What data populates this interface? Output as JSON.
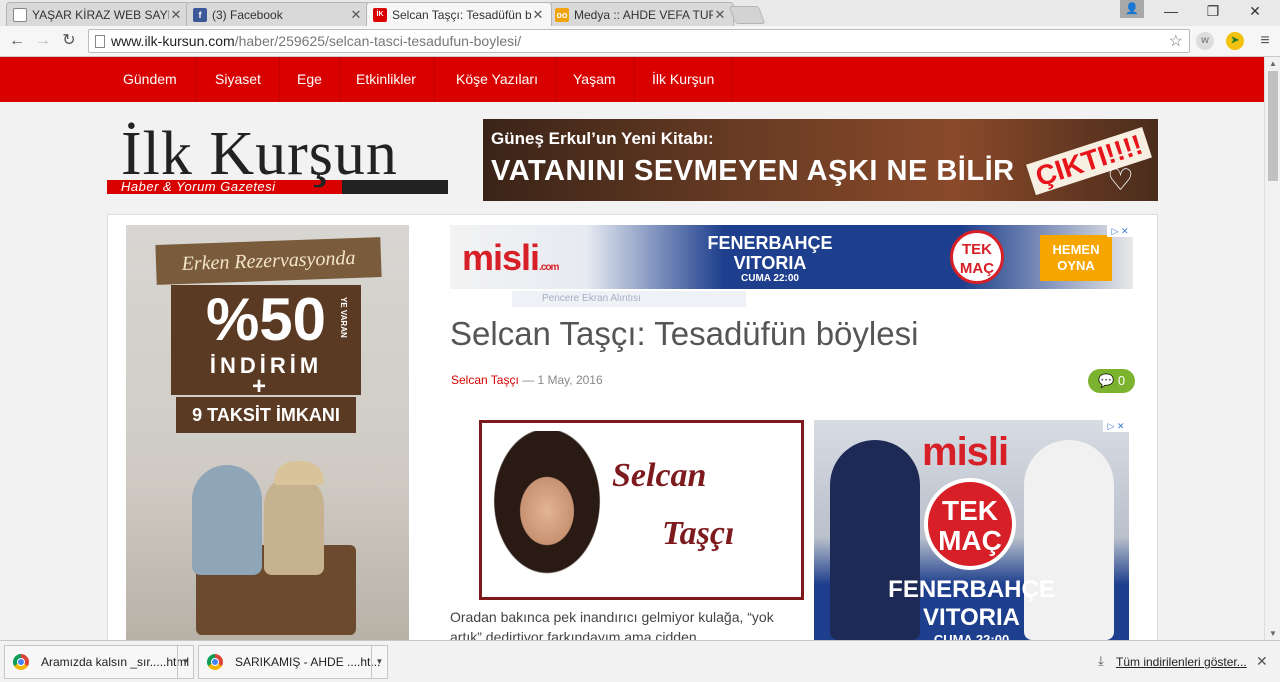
{
  "browser": {
    "tabs": [
      {
        "title": "YAŞAR KİRAZ WEB SAYFAS",
        "favicon": "page-icon"
      },
      {
        "title": "(3) Facebook",
        "favicon": "facebook-icon"
      },
      {
        "title": "Selcan Taşçı: Tesadüfün bö",
        "favicon": "ilk-kursun-icon"
      },
      {
        "title": "Medya :: AHDE VEFA TURA",
        "favicon": "owl-icon"
      }
    ],
    "url_host": "www.ilk-kursun.com",
    "url_path": "/haber/259625/selcan-tasci-tesadufun-boylesi/",
    "window_controls": {
      "minimize": "—",
      "restore": "❐",
      "close": "✕"
    }
  },
  "site": {
    "nav": [
      "Gündem",
      "Siyaset",
      "Ege",
      "Etkinlikler",
      "Köşe Yazıları",
      "Yaşam",
      "İlk Kurşun"
    ],
    "logo_text": "İlk Kurşun",
    "logo_subtitle": "Haber & Yorum Gazetesi",
    "colors": {
      "brand_red": "#d90000",
      "comment_green": "#7bb32e",
      "author_frame": "#7d1a1e"
    }
  },
  "banner_top": {
    "line1": "Güneş Erkul’un Yeni Kitabı:",
    "line2": "VATANINI SEVMEYEN AŞKI NE BİLİR",
    "badge": "ÇIKTI!!!!"
  },
  "side_ad": {
    "ribbon": "Erken Rezervasyonda",
    "percent": "%50",
    "ye_varan": "YE VARAN",
    "discount": "İNDİRİM",
    "plus": "+",
    "installments": "9 TAKSİT İMKANI"
  },
  "ad_strip": {
    "brand": "misli",
    "brand_domain": ".com",
    "team1": "FENERBAHÇE",
    "team2": "VITORIA",
    "time": "CUMA 22:00",
    "tek": "TEK",
    "mac": "MAÇ",
    "cta1": "HEMEN",
    "cta2": "OYNA",
    "adchoice": "▷ ✕",
    "tooltip_ghost": "Pencere Ekran Alıntısı"
  },
  "article": {
    "title": "Selcan Taşçı: Tesadüfün böylesi",
    "author": "Selcan Taşçı",
    "date_sep": " — ",
    "date": "1 May, 2016",
    "comments": "0",
    "author_image_first": "Selcan",
    "author_image_last": "Taşçı",
    "body": "Oradan bakınca pek inandırıcı gelmiyor kulağa, “yok artık” dedirtiyor farkındayım ama cidden tesadüf!Tarihini"
  },
  "ad_box": {
    "brand": "misli",
    "tek": "TEK",
    "mac": "MAÇ",
    "team1": "FENERBAHÇE",
    "team2": "VITORIA",
    "time": "CUMA 22:00"
  },
  "downloads": {
    "items": [
      "Aramızda kalsın _sır.....html",
      "SARIKAMIŞ - AHDE ....ht..."
    ],
    "show_all": "Tüm indirilenleri göster..."
  }
}
